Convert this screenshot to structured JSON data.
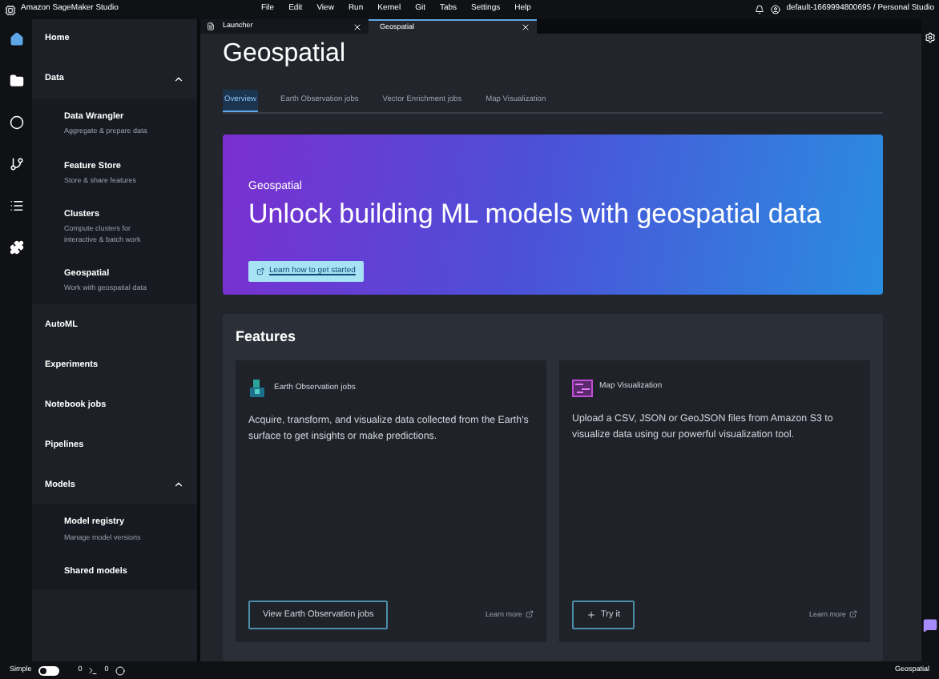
{
  "app": {
    "title": "Amazon SageMaker Studio"
  },
  "menu": [
    "File",
    "Edit",
    "View",
    "Run",
    "Kernel",
    "Git",
    "Tabs",
    "Settings",
    "Help"
  ],
  "account": "default-1669994800695 / Personal Studio",
  "sidebar": [
    {
      "label": "Home"
    },
    {
      "label": "Data",
      "expanded": true,
      "children": [
        {
          "label": "Data Wrangler",
          "subtitle": "Aggregate & prepare data"
        },
        {
          "label": "Feature Store",
          "subtitle": "Store & share features"
        },
        {
          "label": "Clusters",
          "subtitle": "Compute clusters for interactive & batch work"
        },
        {
          "label": "Geospatial",
          "subtitle": "Work with geospatial data"
        }
      ]
    },
    {
      "label": "AutoML"
    },
    {
      "label": "Experiments"
    },
    {
      "label": "Notebook jobs"
    },
    {
      "label": "Pipelines"
    },
    {
      "label": "Models",
      "expanded": true,
      "children": [
        {
          "label": "Model registry",
          "subtitle": "Manage model versions"
        },
        {
          "label": "Shared models"
        }
      ]
    }
  ],
  "doc_tabs": [
    {
      "label": "Launcher",
      "selected": false
    },
    {
      "label": "Geospatial",
      "selected": true
    }
  ],
  "page": {
    "title": "Geospatial",
    "tabs": [
      {
        "label": "Overview",
        "selected": true
      },
      {
        "label": "Earth Observation jobs",
        "selected": false
      },
      {
        "label": "Vector Enrichment jobs",
        "selected": false
      },
      {
        "label": "Map Visualization",
        "selected": false
      }
    ],
    "hero": {
      "eyebrow": "Geospatial",
      "headline": "Unlock building ML models with geospatial data",
      "button": "Learn how to get started"
    },
    "features_title": "Features",
    "features": [
      {
        "kind": "earth",
        "title": "Earth Observation jobs",
        "description": "Acquire, transform, and visualize data collected from the Earth's surface to get insights or make predictions.",
        "action": "View Earth Observation jobs",
        "link": "Learn more"
      },
      {
        "kind": "map",
        "title": "Map Visualization",
        "description": "Upload a CSV, JSON or GeoJSON files from Amazon S3 to visualize data using our powerful visualization tool.",
        "action": "Try it",
        "link": "Learn more"
      }
    ]
  },
  "status_bar": {
    "mode": "Simple",
    "simple_on": false,
    "count_1": "0",
    "count_2": "0",
    "right": "Geospatial"
  }
}
